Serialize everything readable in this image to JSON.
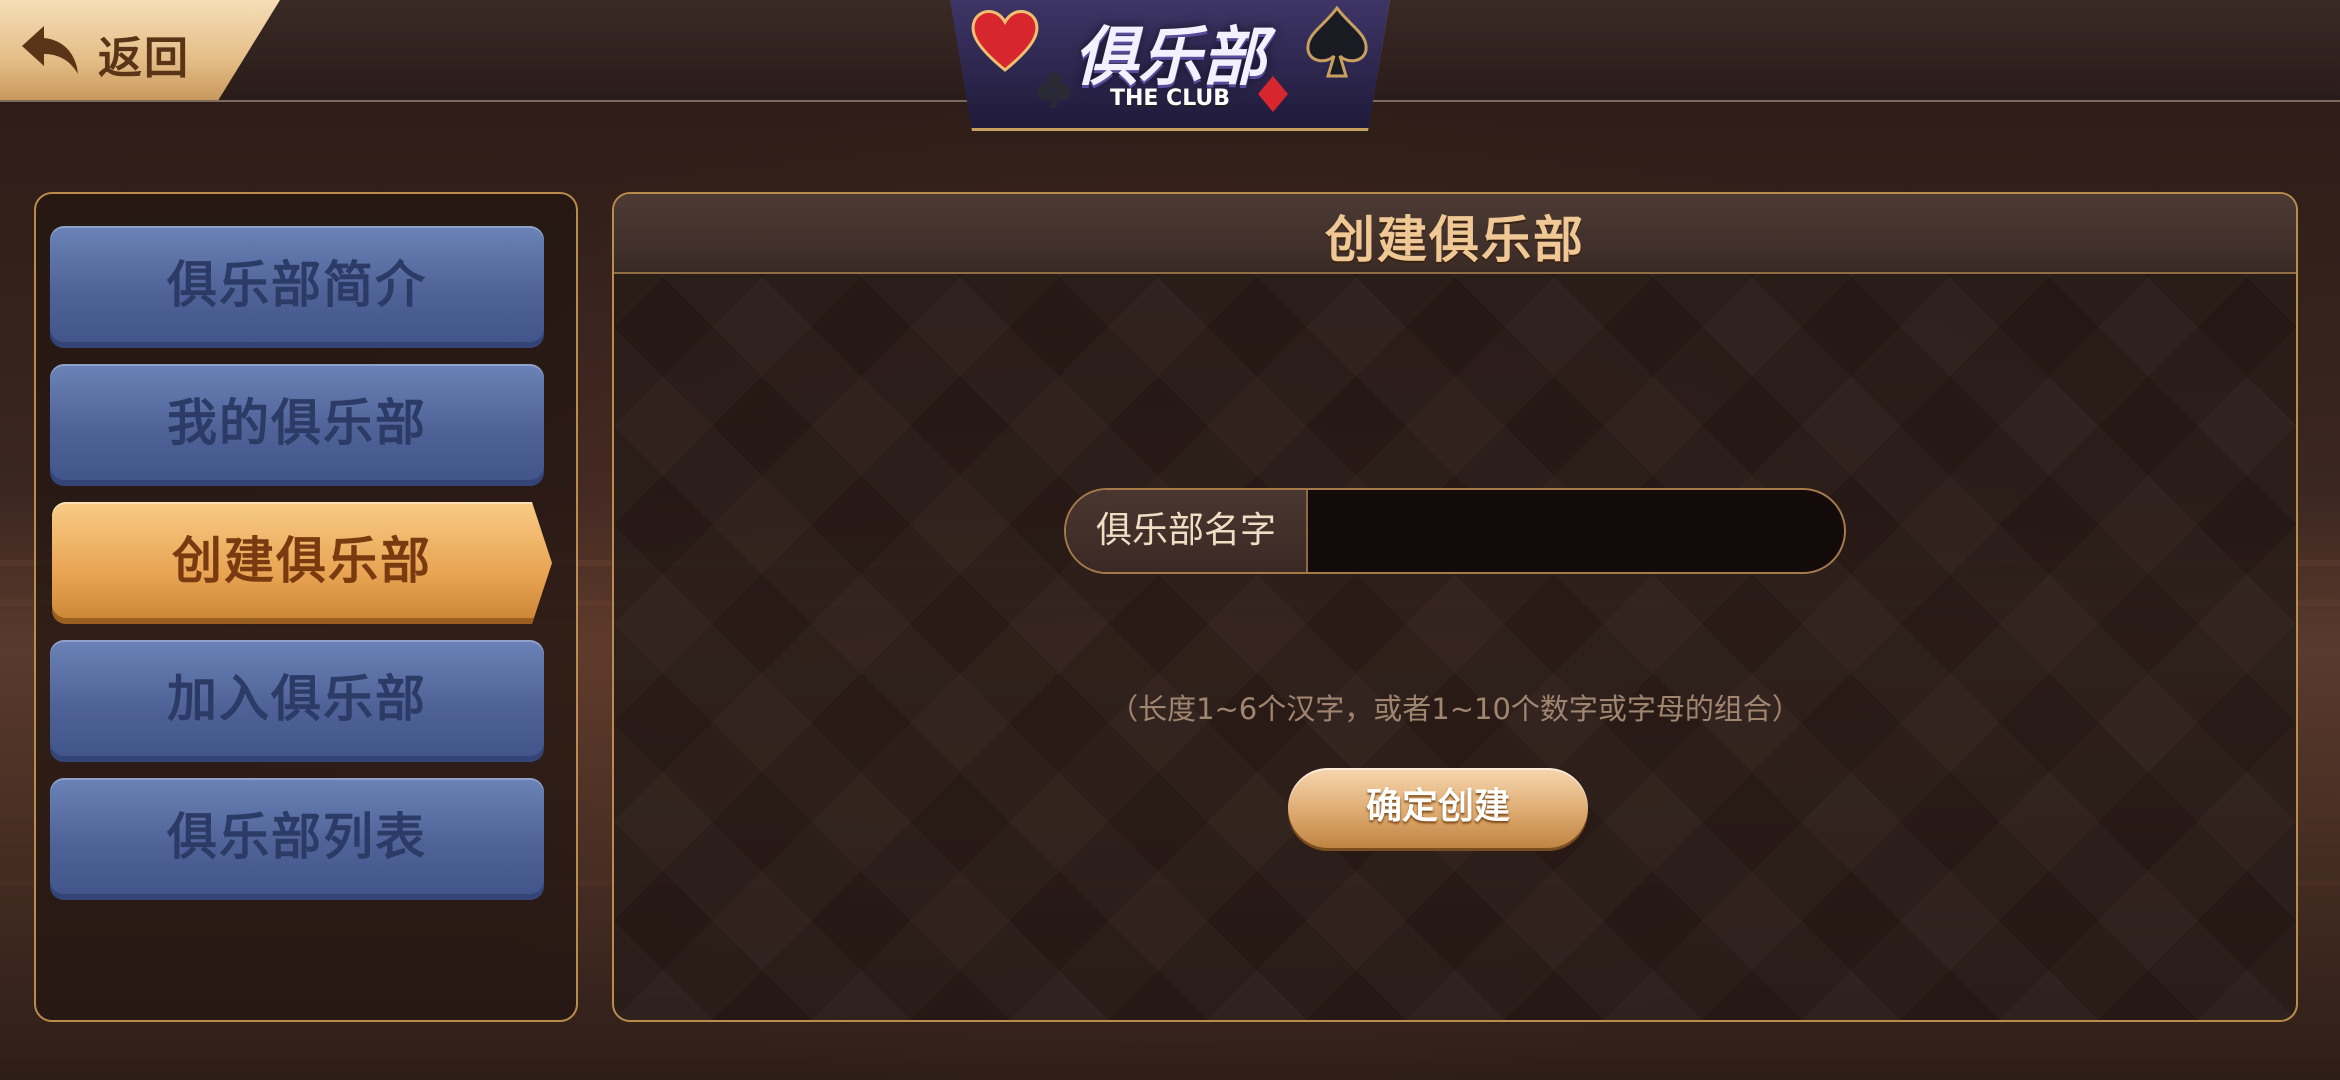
{
  "header": {
    "back_label": "返回",
    "logo_title": "俱乐部",
    "logo_subtitle": "THE CLUB"
  },
  "sidebar": {
    "items": [
      {
        "label": "俱乐部简介",
        "active": false
      },
      {
        "label": "我的俱乐部",
        "active": false
      },
      {
        "label": "创建俱乐部",
        "active": true
      },
      {
        "label": "加入俱乐部",
        "active": false
      },
      {
        "label": "俱乐部列表",
        "active": false
      }
    ]
  },
  "main": {
    "title": "创建俱乐部",
    "name_label": "俱乐部名字",
    "name_value": "",
    "name_placeholder": "",
    "hint": "（长度1~6个汉字，或者1~10个数字或字母的组合）",
    "confirm_label": "确定创建"
  },
  "colors": {
    "accent_gold": "#e8a352",
    "menu_blue": "#4f6297",
    "panel_border": "#b98c4c"
  }
}
